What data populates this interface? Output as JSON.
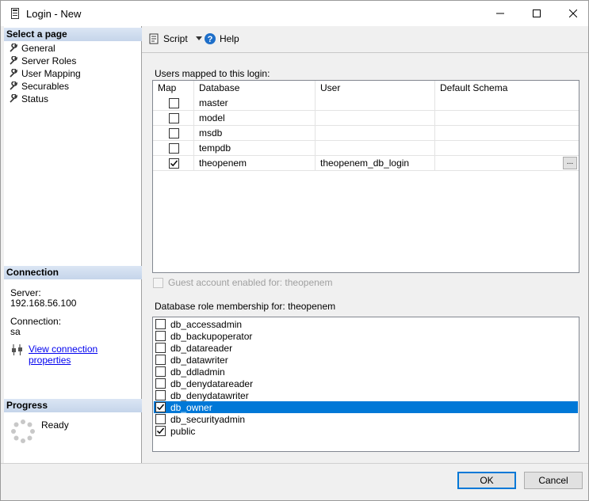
{
  "window": {
    "title": "Login - New"
  },
  "left": {
    "select_page_header": "Select a page",
    "pages": [
      {
        "label": "General"
      },
      {
        "label": "Server Roles"
      },
      {
        "label": "User Mapping"
      },
      {
        "label": "Securables"
      },
      {
        "label": "Status"
      }
    ],
    "connection_header": "Connection",
    "server_label": "Server:",
    "server_value": "192.168.56.100",
    "connection_label": "Connection:",
    "connection_value": "sa",
    "view_connection_link": "View connection properties",
    "progress_header": "Progress",
    "progress_status": "Ready"
  },
  "toolbar": {
    "script_label": "Script",
    "help_label": "Help"
  },
  "mapping": {
    "label": "Users mapped to this login:",
    "columns": [
      "Map",
      "Database",
      "User",
      "Default Schema"
    ],
    "rows": [
      {
        "map": false,
        "database": "master",
        "user": "",
        "schema": ""
      },
      {
        "map": false,
        "database": "model",
        "user": "",
        "schema": ""
      },
      {
        "map": false,
        "database": "msdb",
        "user": "",
        "schema": ""
      },
      {
        "map": false,
        "database": "tempdb",
        "user": "",
        "schema": ""
      },
      {
        "map": true,
        "database": "theopenem",
        "user": "theopenem_db_login",
        "schema": ""
      }
    ],
    "ellipsis_label": "..."
  },
  "guest": {
    "label": "Guest account enabled for: theopenem",
    "checked": false
  },
  "roles": {
    "label": "Database role membership for: theopenem",
    "items": [
      {
        "name": "db_accessadmin",
        "checked": false
      },
      {
        "name": "db_backupoperator",
        "checked": false
      },
      {
        "name": "db_datareader",
        "checked": false
      },
      {
        "name": "db_datawriter",
        "checked": false
      },
      {
        "name": "db_ddladmin",
        "checked": false
      },
      {
        "name": "db_denydatareader",
        "checked": false
      },
      {
        "name": "db_denydatawriter",
        "checked": false
      },
      {
        "name": "db_owner",
        "checked": true,
        "selected": true
      },
      {
        "name": "db_securityadmin",
        "checked": false
      },
      {
        "name": "public",
        "checked": true
      }
    ]
  },
  "buttons": {
    "ok": "OK",
    "cancel": "Cancel"
  },
  "colors": {
    "selection": "#0078d7",
    "link": "#0000ee",
    "header_gradient": "#c5d5ea"
  }
}
